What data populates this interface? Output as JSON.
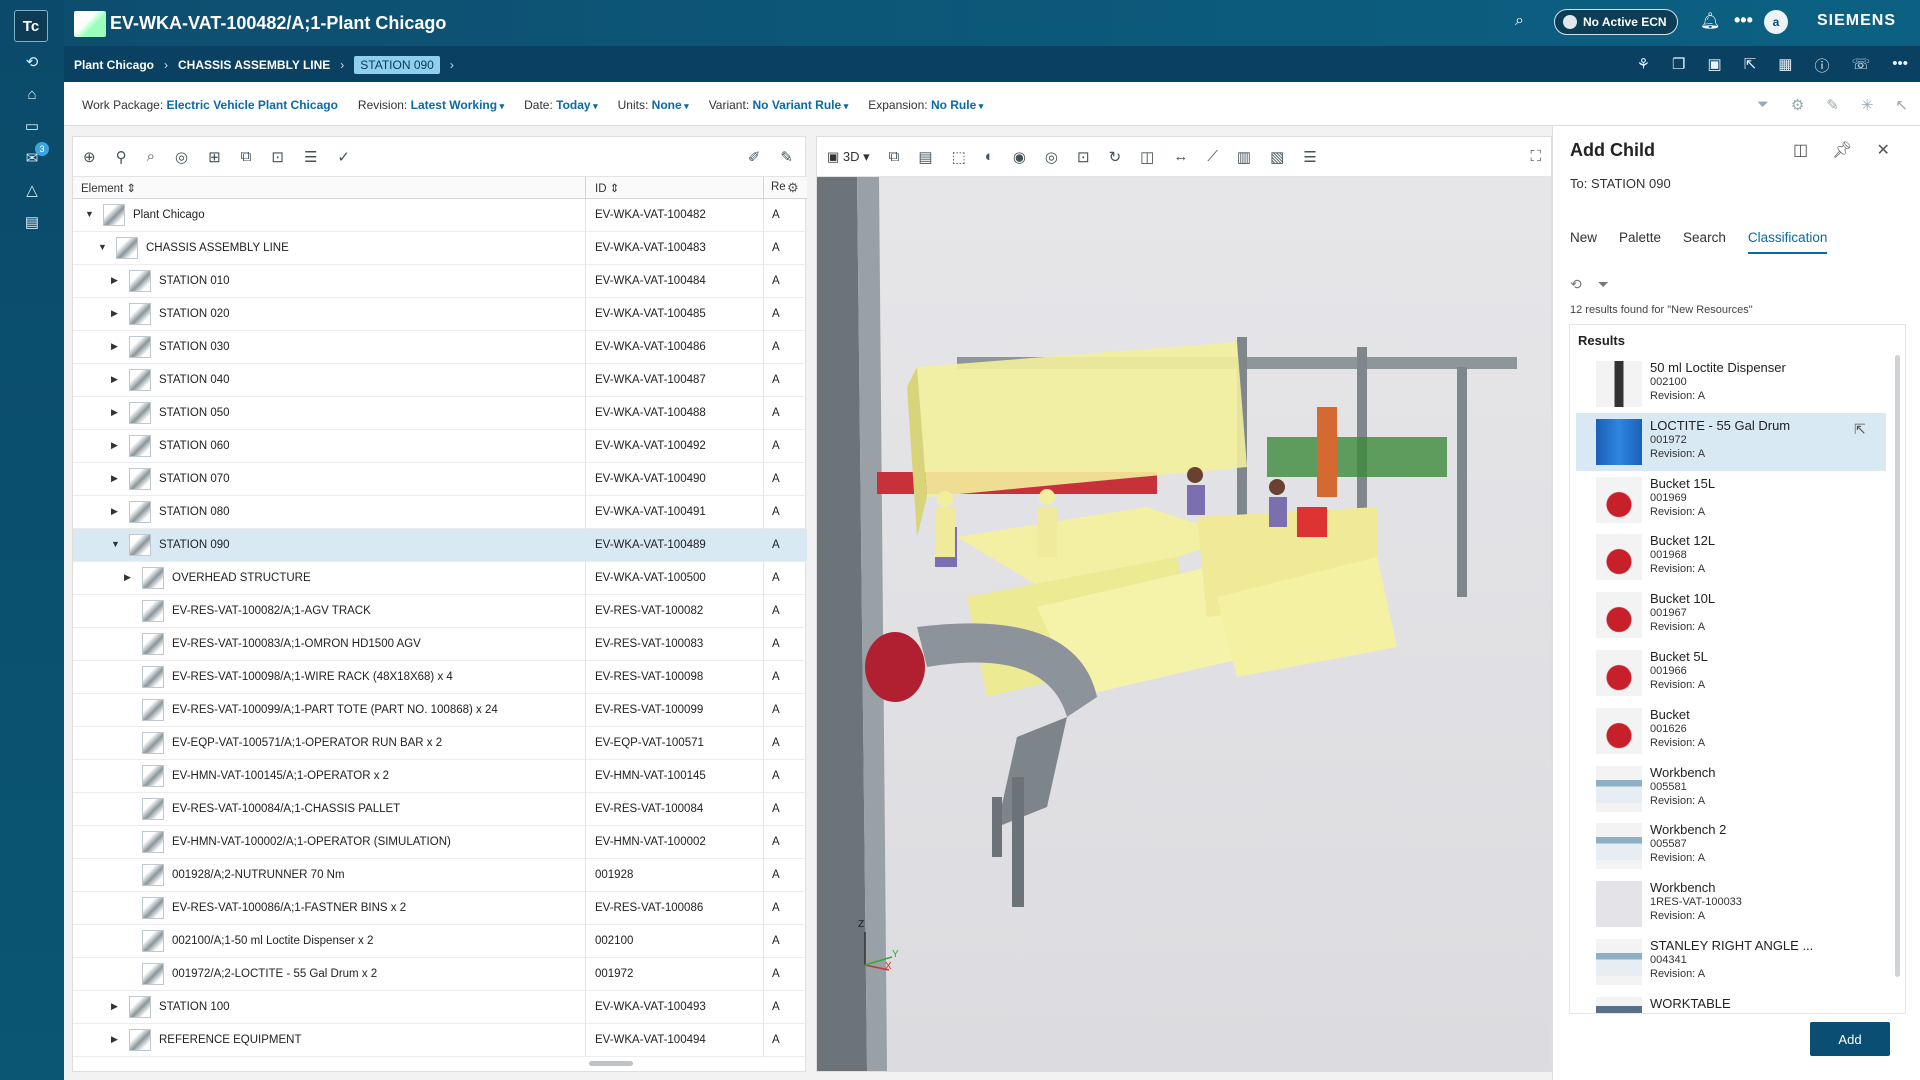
{
  "app": {
    "logo": "Tc",
    "title": "EV-WKA-VAT-100482/A;1-Plant Chicago",
    "ecn": "No Active ECN",
    "user_initial": "a",
    "brand": "SIEMENS",
    "notif_count": "3"
  },
  "breadcrumb": [
    "Plant Chicago",
    "CHASSIS ASSEMBLY LINE",
    "STATION 090"
  ],
  "context": {
    "work_package_label": "Work Package:",
    "work_package": "Electric Vehicle Plant Chicago",
    "revision_label": "Revision:",
    "revision": "Latest Working",
    "date_label": "Date:",
    "date": "Today",
    "units_label": "Units:",
    "units": "None",
    "variant_label": "Variant:",
    "variant": "No Variant Rule",
    "expansion_label": "Expansion:",
    "expansion": "No Rule"
  },
  "tree": {
    "col_element": "Element",
    "col_id": "ID",
    "col_rev": "Re",
    "rows": [
      {
        "name": "Plant Chicago",
        "id": "EV-WKA-VAT-100482",
        "rev": "A"
      },
      {
        "name": "CHASSIS ASSEMBLY LINE",
        "id": "EV-WKA-VAT-100483",
        "rev": "A"
      },
      {
        "name": "STATION 010",
        "id": "EV-WKA-VAT-100484",
        "rev": "A"
      },
      {
        "name": "STATION 020",
        "id": "EV-WKA-VAT-100485",
        "rev": "A"
      },
      {
        "name": "STATION 030",
        "id": "EV-WKA-VAT-100486",
        "rev": "A"
      },
      {
        "name": "STATION 040",
        "id": "EV-WKA-VAT-100487",
        "rev": "A"
      },
      {
        "name": "STATION 050",
        "id": "EV-WKA-VAT-100488",
        "rev": "A"
      },
      {
        "name": "STATION 060",
        "id": "EV-WKA-VAT-100492",
        "rev": "A"
      },
      {
        "name": "STATION 070",
        "id": "EV-WKA-VAT-100490",
        "rev": "A"
      },
      {
        "name": "STATION 080",
        "id": "EV-WKA-VAT-100491",
        "rev": "A"
      },
      {
        "name": "STATION 090",
        "id": "EV-WKA-VAT-100489",
        "rev": "A"
      },
      {
        "name": "OVERHEAD STRUCTURE",
        "id": "EV-WKA-VAT-100500",
        "rev": "A"
      },
      {
        "name": "EV-RES-VAT-100082/A;1-AGV TRACK",
        "id": "EV-RES-VAT-100082",
        "rev": "A"
      },
      {
        "name": "EV-RES-VAT-100083/A;1-OMRON HD1500 AGV",
        "id": "EV-RES-VAT-100083",
        "rev": "A"
      },
      {
        "name": "EV-RES-VAT-100098/A;1-WIRE RACK (48X18X68) x 4",
        "id": "EV-RES-VAT-100098",
        "rev": "A"
      },
      {
        "name": "EV-RES-VAT-100099/A;1-PART TOTE (PART NO. 100868) x 24",
        "id": "EV-RES-VAT-100099",
        "rev": "A"
      },
      {
        "name": "EV-EQP-VAT-100571/A;1-OPERATOR RUN BAR x 2",
        "id": "EV-EQP-VAT-100571",
        "rev": "A"
      },
      {
        "name": "EV-HMN-VAT-100145/A;1-OPERATOR x 2",
        "id": "EV-HMN-VAT-100145",
        "rev": "A"
      },
      {
        "name": "EV-RES-VAT-100084/A;1-CHASSIS PALLET",
        "id": "EV-RES-VAT-100084",
        "rev": "A"
      },
      {
        "name": "EV-HMN-VAT-100002/A;1-OPERATOR (SIMULATION)",
        "id": "EV-HMN-VAT-100002",
        "rev": "A"
      },
      {
        "name": "001928/A;2-NUTRUNNER 70 Nm",
        "id": "001928",
        "rev": "A"
      },
      {
        "name": "EV-RES-VAT-100086/A;1-FASTNER BINS x 2",
        "id": "EV-RES-VAT-100086",
        "rev": "A"
      },
      {
        "name": "002100/A;1-50 ml Loctite Dispenser x 2",
        "id": "002100",
        "rev": "A"
      },
      {
        "name": "001972/A;2-LOCTITE - 55 Gal Drum x 2",
        "id": "001972",
        "rev": "A"
      },
      {
        "name": "STATION 100",
        "id": "EV-WKA-VAT-100493",
        "rev": "A"
      },
      {
        "name": "REFERENCE EQUIPMENT",
        "id": "EV-WKA-VAT-100494",
        "rev": "A"
      }
    ]
  },
  "viewer": {
    "mode": "3D",
    "axis_z": "Z",
    "axis_y": "Y",
    "axis_x": "X"
  },
  "add_child": {
    "title": "Add Child",
    "to_label": "To:",
    "to_value": "STATION 090",
    "tabs": [
      "New",
      "Palette",
      "Search",
      "Classification"
    ],
    "found": "12 results found for \"New Resources\"",
    "results_header": "Results",
    "rev_label": "Revision:",
    "results": [
      {
        "name": "50 ml Loctite Dispenser",
        "code": "002100",
        "rev": "A"
      },
      {
        "name": "LOCTITE - 55 Gal Drum",
        "code": "001972",
        "rev": "A"
      },
      {
        "name": "Bucket 15L",
        "code": "001969",
        "rev": "A"
      },
      {
        "name": "Bucket 12L",
        "code": "001968",
        "rev": "A"
      },
      {
        "name": "Bucket 10L",
        "code": "001967",
        "rev": "A"
      },
      {
        "name": "Bucket 5L",
        "code": "001966",
        "rev": "A"
      },
      {
        "name": "Bucket",
        "code": "001626",
        "rev": "A"
      },
      {
        "name": "Workbench",
        "code": "005581",
        "rev": "A"
      },
      {
        "name": "Workbench 2",
        "code": "005587",
        "rev": "A"
      },
      {
        "name": "Workbench",
        "code": "1RES-VAT-100033",
        "rev": "A"
      },
      {
        "name": "STANLEY RIGHT ANGLE ...",
        "code": "004341",
        "rev": "A"
      },
      {
        "name": "WORKTABLE",
        "code": "",
        "rev": ""
      }
    ],
    "add_label": "Add"
  },
  "colors": {
    "header": "#0d4e6f",
    "accent": "#0a6aa3",
    "selection": "#d9e9f4",
    "scene_yellow": "#f2ef9c"
  }
}
